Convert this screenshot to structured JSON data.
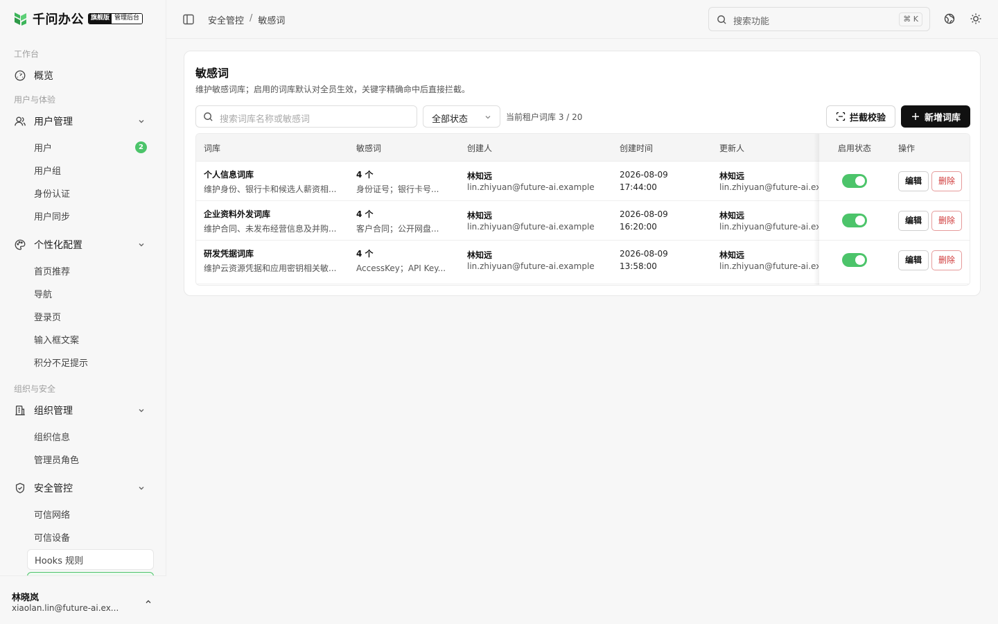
{
  "brand": {
    "name": "千问办公",
    "edition": "旗舰版",
    "console": "管理后台",
    "logo_color": "#3cb55a"
  },
  "sidebar": {
    "groups": [
      {
        "label": "工作台"
      },
      {
        "label": "用户与体验"
      },
      {
        "label": "组织与安全"
      }
    ],
    "items": [
      {
        "label": "概览",
        "icon": "gauge-icon"
      },
      {
        "label": "用户管理",
        "icon": "user-icon",
        "expanded": true,
        "children": [
          {
            "label": "用户",
            "count": "2"
          },
          {
            "label": "用户组"
          },
          {
            "label": "身份认证"
          },
          {
            "label": "用户同步"
          }
        ]
      },
      {
        "label": "个性化配置",
        "icon": "palette-icon",
        "expanded": true,
        "children": [
          {
            "label": "首页推荐"
          },
          {
            "label": "导航"
          },
          {
            "label": "登录页"
          },
          {
            "label": "输入框文案"
          },
          {
            "label": "积分不足提示"
          }
        ]
      },
      {
        "label": "组织管理",
        "icon": "building-icon",
        "expanded": true,
        "children": [
          {
            "label": "组织信息"
          },
          {
            "label": "管理员角色"
          }
        ]
      },
      {
        "label": "安全管控",
        "icon": "shield-icon",
        "expanded": true,
        "children": [
          {
            "label": "可信网络"
          },
          {
            "label": "可信设备"
          },
          {
            "label": "Hooks 规则"
          }
        ]
      }
    ]
  },
  "account": {
    "name": "林晓岚",
    "email": "xiaolan.lin@future-ai.ex..."
  },
  "topbar": {
    "breadcrumb": [
      "安全管控",
      "/",
      "敏感词"
    ],
    "search_placeholder": "搜索功能",
    "shortcut": "⌘ K"
  },
  "page": {
    "title": "敏感词",
    "description": "维护敏感词库；启用的词库默认对全员生效，关键字精确命中后直接拦截。",
    "filter_placeholder": "搜索词库名称或敏感词",
    "status_filter": "全部状态",
    "quota": "当前租户词库 3 / 20",
    "check_button": "拦截校验",
    "add_button": "新增词库"
  },
  "table": {
    "columns": [
      "词库",
      "敏感词",
      "创建人",
      "创建时间",
      "更新人",
      "启用状态",
      "操作"
    ],
    "rows": [
      {
        "name": "个人信息词库",
        "desc": "维护身份、银行卡和候选人薪资相...",
        "count": "4 个",
        "words": "身份证号；银行卡号...",
        "creator": "林知远",
        "creator_email": "lin.zhiyuan@future-ai.example",
        "date": "2026-08-09",
        "time": "17:44:00",
        "updater": "林知远",
        "updater_email": "lin.zhiyuan@future-ai.example",
        "enabled": true,
        "edit": "编辑",
        "delete": "删除"
      },
      {
        "name": "企业资料外发词库",
        "desc": "维护合同、未发布经营信息及并购...",
        "count": "4 个",
        "words": "客户合同；公开网盘...",
        "creator": "林知远",
        "creator_email": "lin.zhiyuan@future-ai.example",
        "date": "2026-08-09",
        "time": "16:20:00",
        "updater": "林知远",
        "updater_email": "lin.zhiyuan@future-ai.example",
        "enabled": true,
        "edit": "编辑",
        "delete": "删除"
      },
      {
        "name": "研发凭据词库",
        "desc": "维护云资源凭据和应用密钥相关敏...",
        "count": "4 个",
        "words": "AccessKey；API Key...",
        "creator": "林知远",
        "creator_email": "lin.zhiyuan@future-ai.example",
        "date": "2026-08-09",
        "time": "13:58:00",
        "updater": "林知远",
        "updater_email": "lin.zhiyuan@future-ai.example",
        "enabled": true,
        "edit": "编辑",
        "delete": "删除"
      }
    ]
  },
  "colors": {
    "accent": "#4cc46a",
    "danger": "#d03a3a",
    "primary_button": "#111111"
  }
}
